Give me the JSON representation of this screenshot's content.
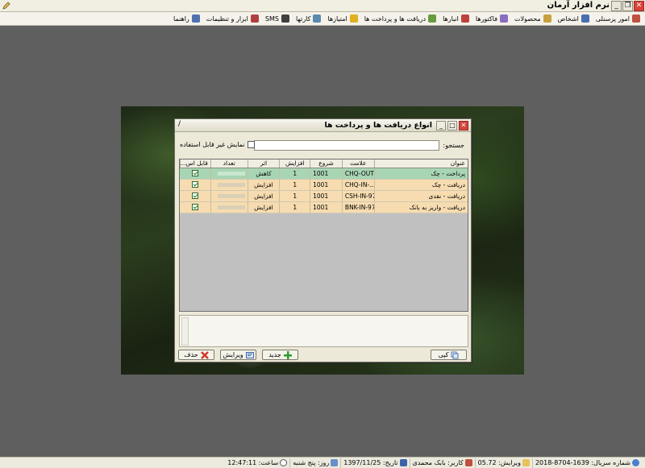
{
  "app": {
    "title": "نرم افزار آرمان",
    "window_buttons": {
      "minimize": "_",
      "restore": "❐",
      "close": "✕"
    }
  },
  "menu": [
    {
      "label": "امور پرسنلی",
      "icon": "people-icon",
      "color": "#c05040"
    },
    {
      "label": "اشخاص",
      "icon": "persons-icon",
      "color": "#4a6fb0"
    },
    {
      "label": "محصولات",
      "icon": "box-icon",
      "color": "#c8a040"
    },
    {
      "label": "فاکتورها",
      "icon": "invoice-icon",
      "color": "#8a6fc0"
    },
    {
      "label": "انبارها",
      "icon": "warehouse-icon",
      "color": "#c04040"
    },
    {
      "label": "دریافت ها و پرداخت ها",
      "icon": "payment-icon",
      "color": "#6a9a40"
    },
    {
      "label": "امتیازها",
      "icon": "star-icon",
      "color": "#e0b020"
    },
    {
      "label": "کارتها",
      "icon": "card-icon",
      "color": "#5a8ab0"
    },
    {
      "label": "SMS",
      "icon": "sms-icon",
      "color": "#404040"
    },
    {
      "label": "ابزار و تنظیمات",
      "icon": "tools-icon",
      "color": "#b04040"
    },
    {
      "label": "راهنما",
      "icon": "help-icon",
      "color": "#5070b0"
    }
  ],
  "dialog": {
    "title": "انواع دریافت ها و پرداخت ها",
    "corner_mark": "/",
    "search_label": "جستجو:",
    "search_value": "",
    "show_unused_label": "نمایش غیر قابل استفاده",
    "show_unused_checked": false,
    "columns": [
      "عنوان",
      "علامت",
      "شروع",
      "افزایش",
      "اثر",
      "تعداد",
      "قابل اس..."
    ],
    "rows": [
      {
        "title": "پرداخت - چک",
        "code": "CHQ-OUT-",
        "start": "1001",
        "increment": "1",
        "effect": "کاهش",
        "usable": true,
        "selected": true
      },
      {
        "title": "دریافت - چک",
        "code": "CHQ-IN-...",
        "start": "1001",
        "increment": "1",
        "effect": "افزایش",
        "usable": true,
        "selected": false
      },
      {
        "title": "دریافت - نقدی",
        "code": "CSH-IN-97-",
        "start": "1001",
        "increment": "1",
        "effect": "افزایش",
        "usable": true,
        "selected": false
      },
      {
        "title": "دریافت - واریز به بانک",
        "code": "BNK-IN-97-",
        "start": "1001",
        "increment": "1",
        "effect": "افزایش",
        "usable": true,
        "selected": false
      }
    ],
    "buttons": {
      "copy": "کپی",
      "new": "جدید",
      "edit": "ویرایش",
      "delete": "حذف"
    }
  },
  "status": {
    "serial": "شماره سریال: 1639-8704-2018",
    "version": "ویرایش: 05.72",
    "user": "کاربر: بابک محمدی",
    "date": "تاریخ: 1397/11/25",
    "weekday": "روز: پنج شنبه",
    "time": "ساعت: 12:47:11"
  }
}
